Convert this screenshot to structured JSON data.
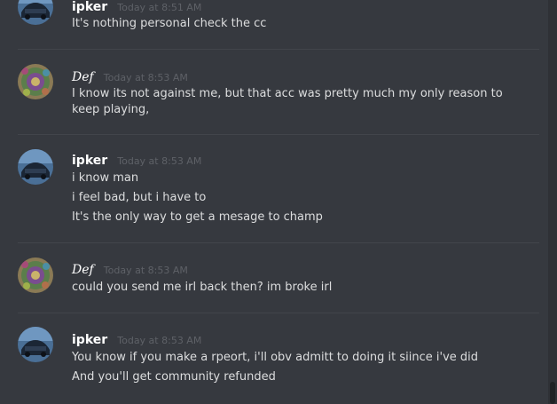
{
  "messages": [
    {
      "author": "ipker",
      "timestamp": "Today at 8:51 AM",
      "avatar": "car-avatar",
      "lines": [
        "It's nothing personal check the cc"
      ]
    },
    {
      "author": "Def",
      "timestamp": "Today at 8:53 AM",
      "avatar": "pattern-avatar",
      "lines": [
        "I know its not against me, but that acc was pretty much my only reason to",
        "keep playing,"
      ]
    },
    {
      "author": "ipker",
      "timestamp": "Today at 8:53 AM",
      "avatar": "car-avatar",
      "lines": [
        "i know man",
        "i feel bad, but i have to",
        "It's the only way to get a mesage to champ"
      ]
    },
    {
      "author": "Def",
      "timestamp": "Today at 8:53 AM",
      "avatar": "pattern-avatar",
      "lines": [
        "could you send me irl back then? im broke irl"
      ]
    },
    {
      "author": "ipker",
      "timestamp": "Today at 8:53 AM",
      "avatar": "car-avatar",
      "lines": [
        "You know if you make a rpeort, i'll obv admitt to doing it siince i've did",
        "And you'll get community refunded"
      ]
    }
  ],
  "colors": {
    "background": "#36393f",
    "author": "#ffffff",
    "timestamp": "#5e6167",
    "text": "#dcddde",
    "divider": "#42454b"
  }
}
